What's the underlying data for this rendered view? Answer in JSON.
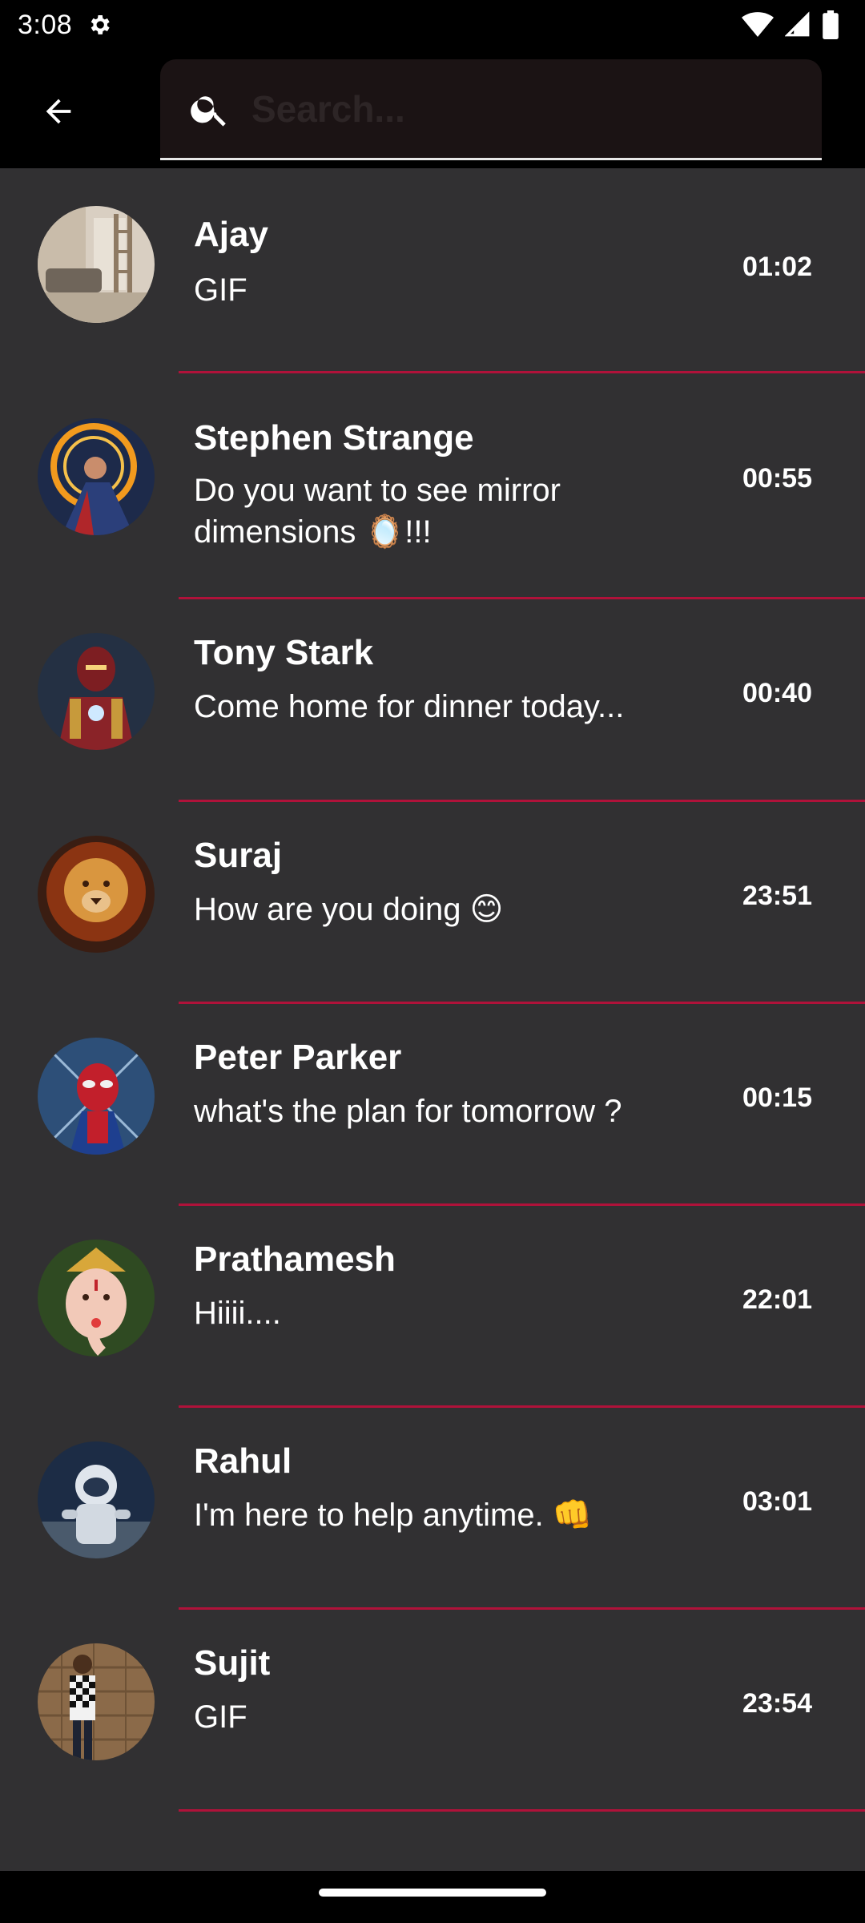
{
  "status_bar": {
    "time": "3:08"
  },
  "search": {
    "placeholder": "Search..."
  },
  "chats": [
    {
      "name": "Ajay",
      "message": "GIF",
      "time": "01:02",
      "avatar": "room-interior-avatar"
    },
    {
      "name": "Stephen Strange",
      "message": "Do you want to see mirror dimensions 🪞!!!",
      "time": "00:55",
      "avatar": "doctor-strange-avatar"
    },
    {
      "name": "Tony Stark",
      "message": "Come home for dinner today...",
      "time": "00:40",
      "avatar": "iron-man-avatar"
    },
    {
      "name": "Suraj",
      "message": "How are you doing 😊",
      "time": "23:51",
      "avatar": "lion-avatar"
    },
    {
      "name": "Peter Parker",
      "message": "what's the plan for tomorrow ?",
      "time": "00:15",
      "avatar": "spider-man-avatar"
    },
    {
      "name": "Prathamesh",
      "message": "Hiiii....",
      "time": "22:01",
      "avatar": "ganesha-avatar"
    },
    {
      "name": "Rahul",
      "message": "I'm here to help anytime. 👊",
      "time": "03:01",
      "avatar": "astronaut-avatar"
    },
    {
      "name": "Sujit",
      "message": "GIF",
      "time": "23:54",
      "avatar": "person-avatar"
    }
  ],
  "colors": {
    "list_background": "#313032",
    "divider": "#b0123a",
    "search_background": "#1b1314",
    "app_bar": "#000000"
  }
}
